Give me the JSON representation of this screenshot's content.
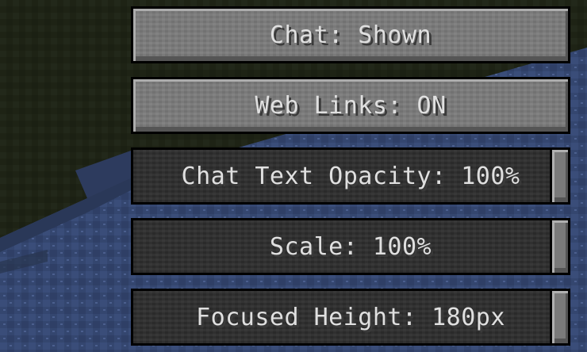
{
  "screen": {
    "buttons": [
      {
        "label": "Chat: Shown"
      },
      {
        "label": "Web Links: ON"
      }
    ],
    "sliders": [
      {
        "label": "Chat Text Opacity: 100%",
        "value": 1.0
      },
      {
        "label": "Scale: 100%",
        "value": 1.0
      },
      {
        "label": "Focused Height: 180px",
        "value": 1.0
      }
    ]
  },
  "colors": {
    "button_face": "#7a7a7a",
    "slider_track": "#2e2e2e",
    "text": "#e0e0e0",
    "text_shadow": "#3a3a3a",
    "world_dark": "#1f2416",
    "water": "#3a4c7a"
  }
}
